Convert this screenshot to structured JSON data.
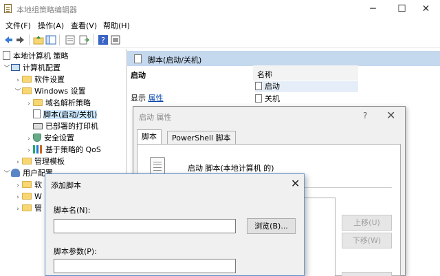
{
  "window": {
    "title": "本地组策略编辑器"
  },
  "menu": [
    "文件(F)",
    "操作(A)",
    "查看(V)",
    "帮助(H)"
  ],
  "tree": {
    "root": "本地计算机 策略",
    "computer_config": "计算机配置",
    "software_settings": "软件设置",
    "windows_settings": "Windows 设置",
    "dns_policy": "域名解析策略",
    "scripts": "脚本(启动/关机)",
    "printers": "已部署的打印机",
    "security": "安全设置",
    "qos": "基于策略的 QoS",
    "admin_templates": "管理模板",
    "user_config": "用户配置",
    "user_sub1": "软",
    "user_sub2": "W",
    "user_sub3": "管"
  },
  "right_pane": {
    "header": "脚本(启动/关机)",
    "section_title": "启动",
    "show_label": "显示",
    "properties_link": "属性",
    "column_name": "名称",
    "items": [
      "启动",
      "关机"
    ]
  },
  "props_dialog": {
    "title": "启动 属性",
    "help": "?",
    "close": "✕",
    "tabs": [
      "脚本",
      "PowerShell 脚本"
    ],
    "panel_label": "启动 脚本(本地计算机 的)",
    "move_up": "上移(U)",
    "move_down": "下移(W)"
  },
  "add_dialog": {
    "title": "添加脚本",
    "close": "✕",
    "script_name_label": "脚本名(N):",
    "script_name_value": "",
    "browse_button": "浏览(B)...",
    "script_params_label": "脚本参数(P):",
    "script_params_value": ""
  }
}
